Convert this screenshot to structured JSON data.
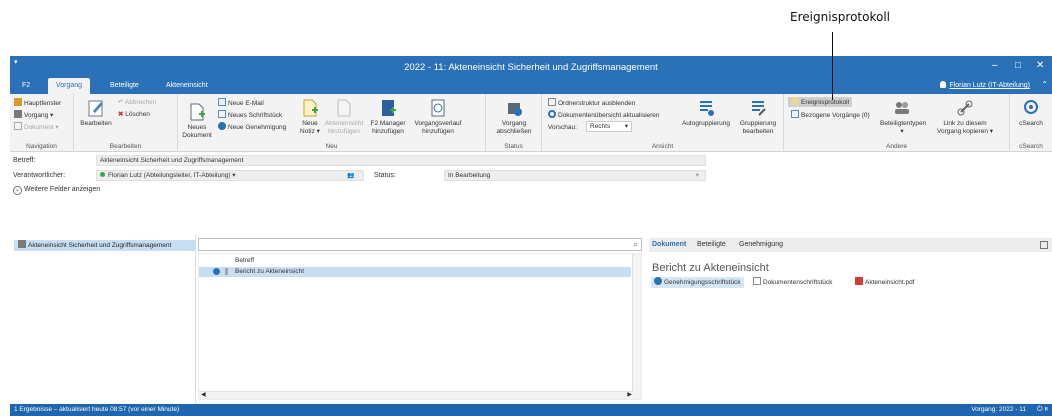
{
  "callout": {
    "label": "Ereignisprotokoll"
  },
  "window": {
    "title": "2022 - 11: Akteneinsicht Sicherheit und Zugriffsmanagement",
    "controls": [
      "–",
      "□",
      "✕"
    ]
  },
  "tabs": [
    "F2",
    "Vorgang",
    "Beteiligte",
    "Akteneinsicht"
  ],
  "active_tab": "Vorgang",
  "user": "Florian Lutz (IT-Abteilung)",
  "ribbon": {
    "navigation": {
      "items": [
        "Hauptfenster",
        "Vorgang ▾",
        "Dokument ▾"
      ],
      "label": "Navigation"
    },
    "bearbeiten": {
      "edit": "Bearbeiten",
      "cancel": "Abbrechen",
      "delete": "Löschen",
      "label": "Bearbeiten"
    },
    "neu": {
      "new_doc": "Neues Dokument",
      "new_mail": "Neue E-Mail",
      "new_letter": "Neues Schriftstück",
      "new_approval": "Neue Genehmigung",
      "new_note": "Neue Notiz ▾",
      "add_files": "Akteneinsicht hinzufügen",
      "f2manager": "F2 Manager hinzufügen",
      "history": "Vorgangsverlauf hinzufügen",
      "label": "Neu"
    },
    "status": {
      "close": "Vorgang abschließen",
      "label": "Status"
    },
    "ansicht": {
      "hide_folders": "Ordnerstruktur ausblenden",
      "refresh": "Dokumentenübersicht aktualisieren",
      "preview_label": "Vorschau:",
      "preview_value": "Rechts",
      "autogroup": "Autogruppierung",
      "edit_group": "Gruppierung bearbeiten",
      "label": "Ansicht"
    },
    "andere": {
      "log": "Ereignisprotokoll",
      "related": "Bezogene Vorgänge (0)",
      "parties": "Beteiligtentypen",
      "link": "Link zu diesem Vorgang kopieren ▾",
      "label": "Andere"
    },
    "csearch": {
      "btn": "cSearch",
      "label": "cSearch"
    }
  },
  "fields": {
    "betreff_label": "Betreff:",
    "betreff_value": "Akteneinsicht Sicherheit und Zugriffsmanagement",
    "verantwortlicher_label": "Verantwortlicher:",
    "verantwortlicher_value": "Florian Lutz (Abteilungsleiter, IT-Abteilung) ▾",
    "status_label": "Status:",
    "status_value": "In Bearbeitung",
    "more_fields": "Weitere Felder anzeigen"
  },
  "tree": {
    "item": "Akteneinsicht Sicherheit und Zugriffsmanagement"
  },
  "list": {
    "column": "Betreff",
    "rows": [
      {
        "title": "Bericht zu Akteneinsicht"
      }
    ]
  },
  "preview": {
    "tabs": [
      "Dokument",
      "Beteiligte",
      "Genehmigung"
    ],
    "title": "Bericht zu Akteneinsicht",
    "attachments": [
      "Genehmigungsschriftstück",
      "Dokumentenschriftstück",
      "Akteneinsicht.pdf"
    ]
  },
  "statusbar": {
    "left": "1 Ergebnisse – aktualisiert heute 08:57 (vor einer Minute)",
    "right": "Vorgang: 2022 - 11"
  },
  "colors": {
    "accent": "#2a71b8",
    "selection": "#c8dff3"
  }
}
